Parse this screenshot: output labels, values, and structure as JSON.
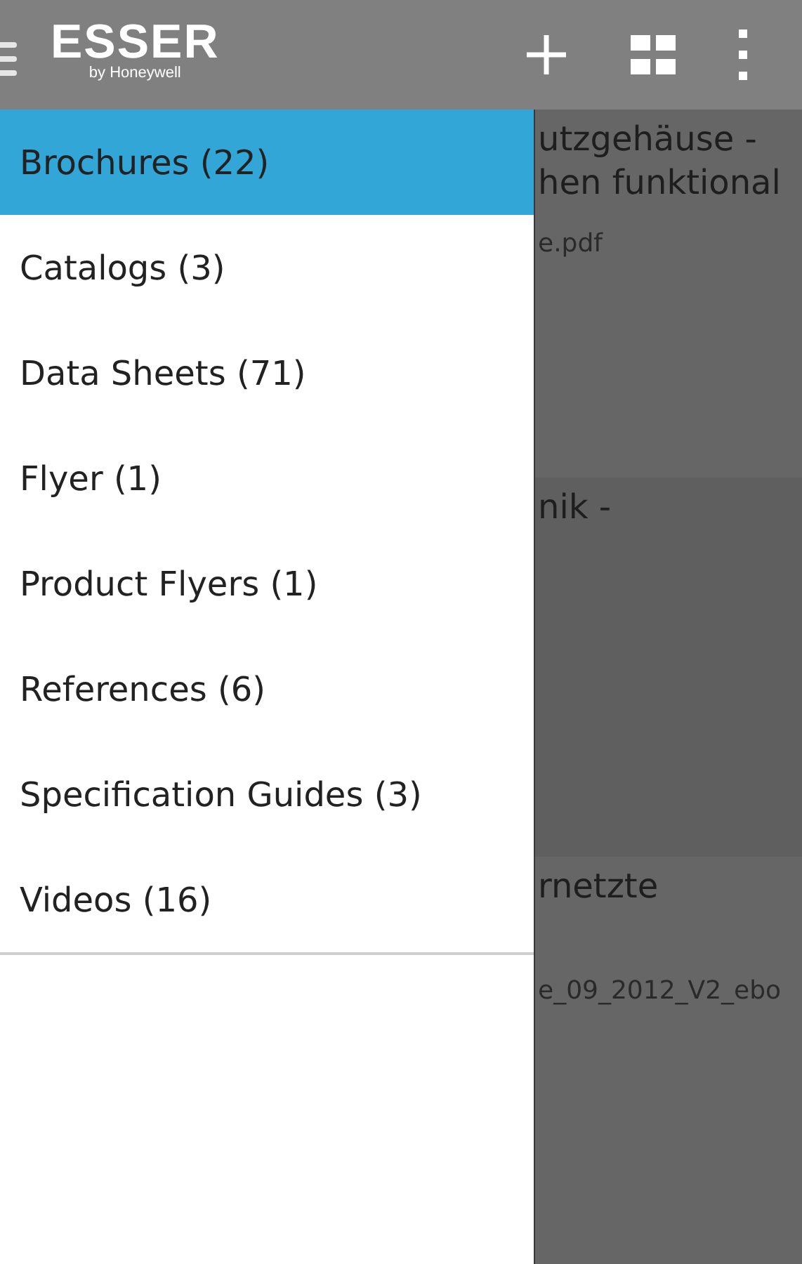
{
  "app_bar": {
    "logo_title": "ESSER",
    "logo_subtitle": "by Honeywell"
  },
  "drawer": {
    "items": [
      {
        "label": "Brochures (22)",
        "selected": true
      },
      {
        "label": "Catalogs (3)",
        "selected": false
      },
      {
        "label": "Data Sheets (71)",
        "selected": false
      },
      {
        "label": "Flyer (1)",
        "selected": false
      },
      {
        "label": "Product Flyers (1)",
        "selected": false
      },
      {
        "label": "References (6)",
        "selected": false
      },
      {
        "label": "Specification Guides (3)",
        "selected": false
      },
      {
        "label": "Videos (16)",
        "selected": false
      }
    ]
  },
  "background_cards": [
    {
      "lines": [
        {
          "kind": "title",
          "text": "utzgehäuse -"
        },
        {
          "kind": "title",
          "text": "hen funktional"
        },
        {
          "kind": "file",
          "text": "e.pdf"
        }
      ]
    },
    {
      "lines": [
        {
          "kind": "title",
          "text": "nik -"
        }
      ]
    },
    {
      "lines": [
        {
          "kind": "title",
          "text": "rnetzte"
        },
        {
          "kind": "gap"
        },
        {
          "kind": "file",
          "text": "e_09_2012_V2_ebo"
        }
      ]
    }
  ]
}
